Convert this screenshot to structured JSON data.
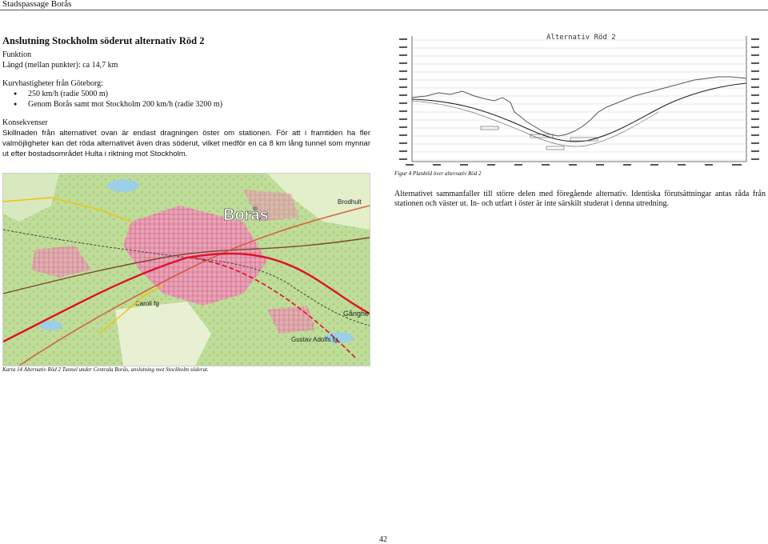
{
  "header": {
    "title": "Stadspassage Borås"
  },
  "section": {
    "heading": "Anslutning Stockholm söderut alternativ Röd 2",
    "funktion_label": "Funktion",
    "length_line": "Längd (mellan punkter): ca 14,7 km",
    "speeds_label": "Kurvhastigheter från Göteborg:",
    "speeds": [
      "250 km/h (radie 5000 m)",
      "Genom Borås samt mot Stockholm 200 km/h (radie 3200 m)"
    ],
    "konsekvenser_label": "Konsekvenser",
    "konsekvenser_line1": "Skillnaden från alternativet ovan är endast dragningen öster om stationen.",
    "konsekvenser_rest": "För att i framtiden ha fler valmöjligheter kan det röda alternativet även dras söderut, vilket medför en ca 8 km lång tunnel som mynnar ut efter bostadsområdet Hulta i riktning mot Stockholm."
  },
  "map": {
    "caption": "Karta 14 Alternativ Röd 2 Tunnel under Centrala Borås, anslutning mot Stockholm söderut.",
    "labels": {
      "city": "Borås",
      "brodhult": "Brodhult",
      "gustav": "Gustav Adolfs fg",
      "gangha": "Gånghe",
      "carol": "Caroli fg"
    }
  },
  "profile": {
    "title": "Alternativ Röd 2",
    "caption": "Figur 4 Planbild över alternativ Röd 2"
  },
  "right_paragraph": "Alternativet sammanfaller till större delen med föregående alternativ. Identiska förutsättningar antas råda från stationen och väster ut. In- och utfart i öster är inte särskilt studerat i denna utredning.",
  "page_number": "42"
}
